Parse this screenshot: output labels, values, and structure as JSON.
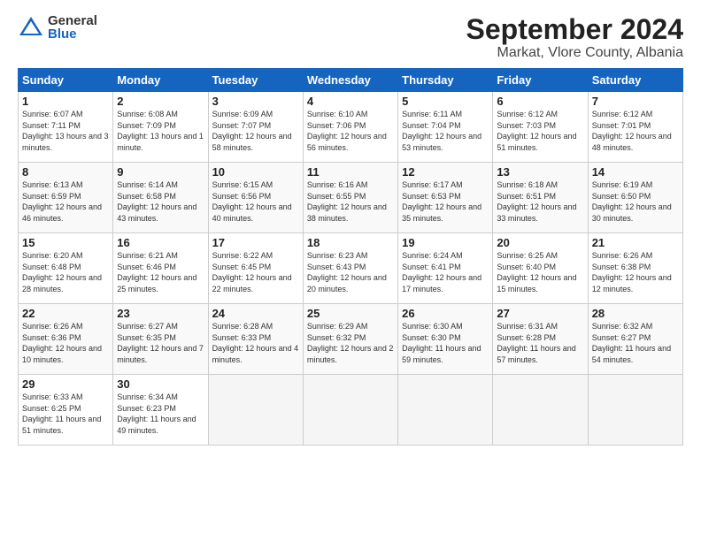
{
  "header": {
    "logo": {
      "general": "General",
      "blue": "Blue"
    },
    "title": "September 2024",
    "location": "Markat, Vlore County, Albania"
  },
  "calendar": {
    "days_of_week": [
      "Sunday",
      "Monday",
      "Tuesday",
      "Wednesday",
      "Thursday",
      "Friday",
      "Saturday"
    ],
    "weeks": [
      [
        null,
        null,
        null,
        null,
        null,
        null,
        null
      ]
    ],
    "cells": [
      {
        "day": null,
        "info": null
      },
      {
        "day": null,
        "info": null
      },
      {
        "day": null,
        "info": null
      },
      {
        "day": null,
        "info": null
      },
      {
        "day": null,
        "info": null
      },
      {
        "day": null,
        "info": null
      },
      {
        "day": null,
        "info": null
      },
      {
        "day": "1",
        "info": "Sunrise: 6:07 AM\nSunset: 7:11 PM\nDaylight: 13 hours\nand 3 minutes."
      },
      {
        "day": "2",
        "info": "Sunrise: 6:08 AM\nSunset: 7:09 PM\nDaylight: 13 hours\nand 1 minute."
      },
      {
        "day": "3",
        "info": "Sunrise: 6:09 AM\nSunset: 7:07 PM\nDaylight: 12 hours\nand 58 minutes."
      },
      {
        "day": "4",
        "info": "Sunrise: 6:10 AM\nSunset: 7:06 PM\nDaylight: 12 hours\nand 56 minutes."
      },
      {
        "day": "5",
        "info": "Sunrise: 6:11 AM\nSunset: 7:04 PM\nDaylight: 12 hours\nand 53 minutes."
      },
      {
        "day": "6",
        "info": "Sunrise: 6:12 AM\nSunset: 7:03 PM\nDaylight: 12 hours\nand 51 minutes."
      },
      {
        "day": "7",
        "info": "Sunrise: 6:12 AM\nSunset: 7:01 PM\nDaylight: 12 hours\nand 48 minutes."
      },
      {
        "day": "8",
        "info": "Sunrise: 6:13 AM\nSunset: 6:59 PM\nDaylight: 12 hours\nand 46 minutes."
      },
      {
        "day": "9",
        "info": "Sunrise: 6:14 AM\nSunset: 6:58 PM\nDaylight: 12 hours\nand 43 minutes."
      },
      {
        "day": "10",
        "info": "Sunrise: 6:15 AM\nSunset: 6:56 PM\nDaylight: 12 hours\nand 40 minutes."
      },
      {
        "day": "11",
        "info": "Sunrise: 6:16 AM\nSunset: 6:55 PM\nDaylight: 12 hours\nand 38 minutes."
      },
      {
        "day": "12",
        "info": "Sunrise: 6:17 AM\nSunset: 6:53 PM\nDaylight: 12 hours\nand 35 minutes."
      },
      {
        "day": "13",
        "info": "Sunrise: 6:18 AM\nSunset: 6:51 PM\nDaylight: 12 hours\nand 33 minutes."
      },
      {
        "day": "14",
        "info": "Sunrise: 6:19 AM\nSunset: 6:50 PM\nDaylight: 12 hours\nand 30 minutes."
      },
      {
        "day": "15",
        "info": "Sunrise: 6:20 AM\nSunset: 6:48 PM\nDaylight: 12 hours\nand 28 minutes."
      },
      {
        "day": "16",
        "info": "Sunrise: 6:21 AM\nSunset: 6:46 PM\nDaylight: 12 hours\nand 25 minutes."
      },
      {
        "day": "17",
        "info": "Sunrise: 6:22 AM\nSunset: 6:45 PM\nDaylight: 12 hours\nand 22 minutes."
      },
      {
        "day": "18",
        "info": "Sunrise: 6:23 AM\nSunset: 6:43 PM\nDaylight: 12 hours\nand 20 minutes."
      },
      {
        "day": "19",
        "info": "Sunrise: 6:24 AM\nSunset: 6:41 PM\nDaylight: 12 hours\nand 17 minutes."
      },
      {
        "day": "20",
        "info": "Sunrise: 6:25 AM\nSunset: 6:40 PM\nDaylight: 12 hours\nand 15 minutes."
      },
      {
        "day": "21",
        "info": "Sunrise: 6:26 AM\nSunset: 6:38 PM\nDaylight: 12 hours\nand 12 minutes."
      },
      {
        "day": "22",
        "info": "Sunrise: 6:26 AM\nSunset: 6:36 PM\nDaylight: 12 hours\nand 10 minutes."
      },
      {
        "day": "23",
        "info": "Sunrise: 6:27 AM\nSunset: 6:35 PM\nDaylight: 12 hours\nand 7 minutes."
      },
      {
        "day": "24",
        "info": "Sunrise: 6:28 AM\nSunset: 6:33 PM\nDaylight: 12 hours\nand 4 minutes."
      },
      {
        "day": "25",
        "info": "Sunrise: 6:29 AM\nSunset: 6:32 PM\nDaylight: 12 hours\nand 2 minutes."
      },
      {
        "day": "26",
        "info": "Sunrise: 6:30 AM\nSunset: 6:30 PM\nDaylight: 11 hours\nand 59 minutes."
      },
      {
        "day": "27",
        "info": "Sunrise: 6:31 AM\nSunset: 6:28 PM\nDaylight: 11 hours\nand 57 minutes."
      },
      {
        "day": "28",
        "info": "Sunrise: 6:32 AM\nSunset: 6:27 PM\nDaylight: 11 hours\nand 54 minutes."
      },
      {
        "day": "29",
        "info": "Sunrise: 6:33 AM\nSunset: 6:25 PM\nDaylight: 11 hours\nand 51 minutes."
      },
      {
        "day": "30",
        "info": "Sunrise: 6:34 AM\nSunset: 6:23 PM\nDaylight: 11 hours\nand 49 minutes."
      },
      {
        "day": null,
        "info": null
      },
      {
        "day": null,
        "info": null
      },
      {
        "day": null,
        "info": null
      },
      {
        "day": null,
        "info": null
      },
      {
        "day": null,
        "info": null
      }
    ]
  }
}
